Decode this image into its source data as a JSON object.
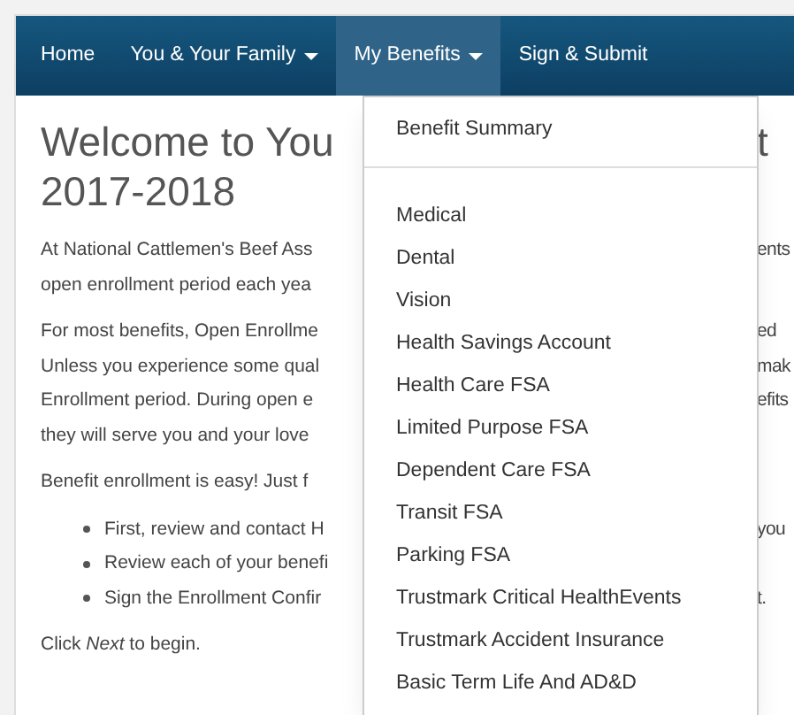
{
  "nav": [
    {
      "label": "Home",
      "caret": false,
      "selected": false
    },
    {
      "label": "You & Your Family",
      "caret": true,
      "selected": false
    },
    {
      "label": "My Benefits",
      "caret": true,
      "selected": true
    },
    {
      "label": "Sign & Submit",
      "caret": false,
      "selected": false
    }
  ],
  "menu": [
    {
      "kind": "item",
      "label": "Benefit Summary"
    },
    {
      "kind": "divider"
    },
    {
      "kind": "item",
      "label": "Medical"
    },
    {
      "kind": "item",
      "label": "Dental"
    },
    {
      "kind": "item",
      "label": "Vision"
    },
    {
      "kind": "item",
      "label": "Health Savings Account"
    },
    {
      "kind": "item",
      "label": "Health Care FSA"
    },
    {
      "kind": "item",
      "label": "Limited Purpose FSA"
    },
    {
      "kind": "item",
      "label": "Dependent Care FSA"
    },
    {
      "kind": "item",
      "label": "Transit FSA"
    },
    {
      "kind": "item",
      "label": "Parking FSA"
    },
    {
      "kind": "item",
      "label": "Trustmark Critical HealthEvents"
    },
    {
      "kind": "item",
      "label": "Trustmark Accident Insurance"
    },
    {
      "kind": "item",
      "label": "Basic Term Life And AD&D"
    }
  ],
  "title": [
    {
      "left": "Welcome to You",
      "right": "t"
    },
    {
      "left": "2017-2018"
    }
  ],
  "paragraphs": [
    {
      "kind": "text",
      "lines": [
        {
          "left": "At National Cattlemen's Beef Ass",
          "right": "ents"
        },
        {
          "left": "open enrollment period each yea"
        }
      ]
    },
    {
      "kind": "text",
      "lines": [
        {
          "left": "For most benefits, Open Enrollme",
          "right": "ed"
        },
        {
          "left": "Unless you experience some qual",
          "right": "mak"
        },
        {
          "left": "Enrollment period. During open e",
          "right": "efits"
        },
        {
          "left": "they will serve you and your love"
        }
      ]
    },
    {
      "kind": "text",
      "lines": [
        {
          "left": "Benefit enrollment is easy! Just f"
        }
      ]
    },
    {
      "kind": "bullets",
      "lines": [
        {
          "left": "First, review and contact H",
          "right": "you"
        },
        {
          "left": "Review each of your benefi"
        },
        {
          "left": "Sign the Enrollment Confir",
          "right": "t."
        }
      ]
    },
    {
      "kind": "text",
      "lines": [
        {
          "left": "Click *Next* to begin."
        }
      ]
    }
  ]
}
